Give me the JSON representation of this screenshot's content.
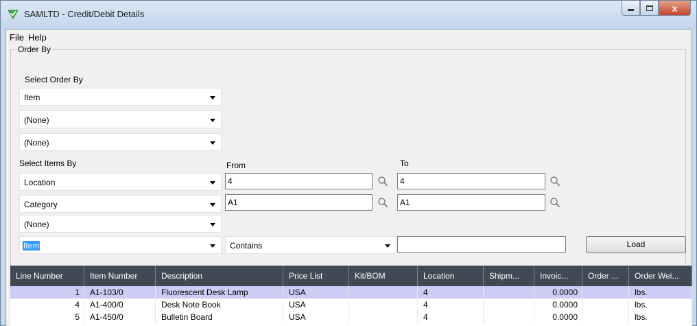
{
  "window": {
    "title": "SAMLTD - Credit/Debit Details",
    "close_glyph": "x"
  },
  "menu": {
    "file": "File",
    "help": "Help"
  },
  "order_by": {
    "legend": "Order By",
    "select_label": "Select Order By",
    "fields": [
      "Item",
      "(None)",
      "(None)"
    ]
  },
  "items_by": {
    "label": "Select Items By",
    "from_label": "From",
    "to_label": "To",
    "rows": [
      {
        "field": "Location",
        "from": "4",
        "to": "4"
      },
      {
        "field": "Category",
        "from": "A1",
        "to": "A1"
      },
      {
        "field": "(None)"
      }
    ],
    "filter": {
      "field": "Item",
      "operator": "Contains",
      "value": ""
    }
  },
  "load_label": "Load",
  "grid": {
    "columns": [
      "Line Number",
      "Item Number",
      "Description",
      "Price List",
      "Kit/BOM",
      "Location",
      "Shipm...",
      "Invoic...",
      "Order ...",
      "Order Wei..."
    ],
    "rows": [
      [
        "1",
        "A1-103/0",
        "Fluorescent Desk Lamp",
        "USA",
        "",
        "4",
        "",
        "0.0000",
        "",
        "lbs."
      ],
      [
        "4",
        "A1-400/0",
        "Desk Note Book",
        "USA",
        "",
        "4",
        "",
        "0.0000",
        "",
        "lbs."
      ],
      [
        "5",
        "A1-450/0",
        "Bulletin Board",
        "USA",
        "",
        "4",
        "",
        "0.0000",
        "",
        "lbs."
      ]
    ]
  },
  "colors": {
    "header_bg": "#404a55",
    "selected_row": "#ccccf5",
    "selection_highlight": "#3399ff",
    "app_icon": "#3fae49"
  }
}
